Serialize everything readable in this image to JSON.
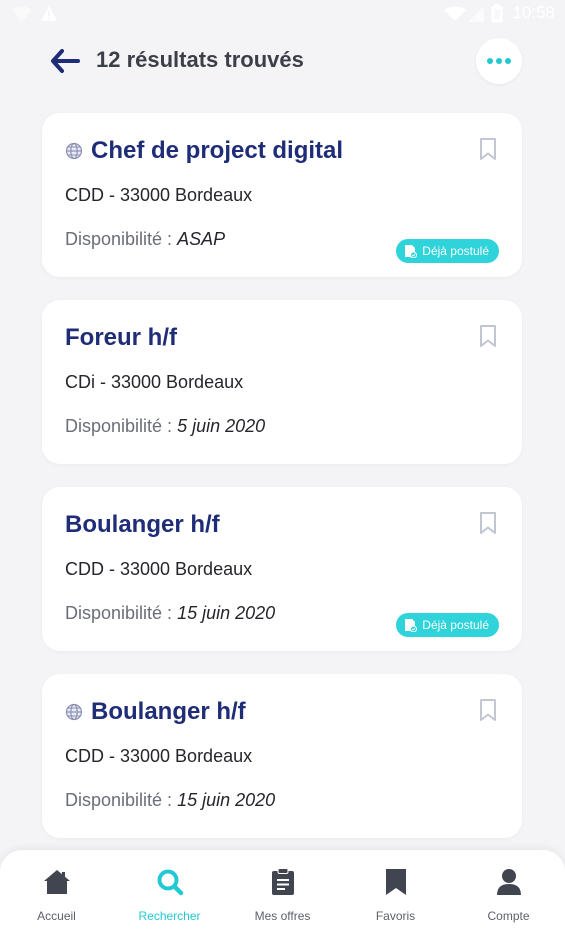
{
  "status_bar": {
    "time": "10:58"
  },
  "header": {
    "title": "12 résultats trouvés"
  },
  "colors": {
    "accent": "#22c9d2",
    "title": "#1f2d78",
    "badge": "#2fd3da"
  },
  "results": [
    {
      "title": "Chef de project digital",
      "contract": "CDD - 33000 Bordeaux",
      "availability_label": "Disponibilité : ",
      "availability_value": "ASAP",
      "badge": "Déjà postulé"
    },
    {
      "title": "Foreur h/f",
      "contract": "CDi - 33000 Bordeaux",
      "availability_label": "Disponibilité : ",
      "availability_value": "5 juin 2020"
    },
    {
      "title": "Boulanger h/f",
      "contract": "CDD - 33000 Bordeaux",
      "availability_label": "Disponibilité : ",
      "availability_value": "15 juin 2020",
      "badge": "Déjà postulé"
    },
    {
      "title": "Boulanger h/f",
      "contract": "CDD - 33000 Bordeaux",
      "availability_label": "Disponibilité : ",
      "availability_value": "15 juin 2020"
    }
  ],
  "bottom_nav": [
    {
      "label": "Accueil",
      "icon": "home-icon"
    },
    {
      "label": "Rechercher",
      "icon": "search-icon",
      "active": true
    },
    {
      "label": "Mes offres",
      "icon": "clipboard-icon"
    },
    {
      "label": "Favoris",
      "icon": "bookmark-icon"
    },
    {
      "label": "Compte",
      "icon": "user-icon"
    }
  ]
}
